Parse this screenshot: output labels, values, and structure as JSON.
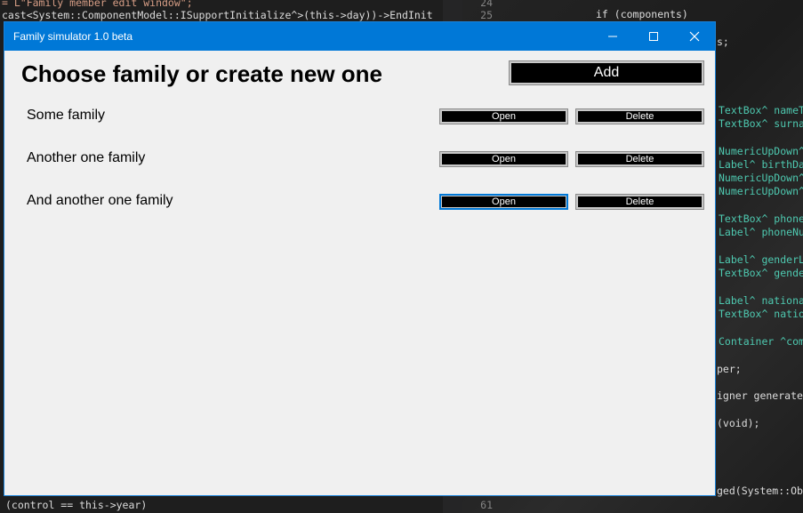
{
  "ide": {
    "left_lines": [
      {
        "text": "= L\"Family member edit window\";",
        "cls": "t-str"
      },
      {
        "text": "cast<System::ComponentModel::ISupportInitialize^>(this->day))->EndInit",
        "cls": "t-plain"
      },
      {
        "text": "(control == this->year)",
        "cls": "t-plain"
      }
    ],
    "gutter": [
      "24",
      "25",
      "61"
    ],
    "right_lines": [
      {
        "text": "if (components)",
        "cls": "t-plain"
      },
      {
        "text": "s;",
        "cls": "t-plain"
      },
      {
        "text": "TextBox^ nameT",
        "cls": "t-type"
      },
      {
        "text": "TextBox^ surna",
        "cls": "t-type"
      },
      {
        "text": "NumericUpDown^",
        "cls": "t-type"
      },
      {
        "text": "Label^ birthDa",
        "cls": "t-type"
      },
      {
        "text": "NumericUpDown^",
        "cls": "t-type"
      },
      {
        "text": "NumericUpDown^",
        "cls": "t-type"
      },
      {
        "text": "TextBox^ phone",
        "cls": "t-type"
      },
      {
        "text": "Label^ phoneNu",
        "cls": "t-type"
      },
      {
        "text": "Label^ genderL",
        "cls": "t-type"
      },
      {
        "text": "TextBox^ gende",
        "cls": "t-type"
      },
      {
        "text": "Label^ nationa",
        "cls": "t-type"
      },
      {
        "text": "TextBox^ natio",
        "cls": "t-type"
      },
      {
        "text": "Container ^com",
        "cls": "t-type"
      },
      {
        "text": "per;",
        "cls": "t-plain"
      },
      {
        "text": "igner generated",
        "cls": "t-plain"
      },
      {
        "text": "(void);",
        "cls": "t-plain"
      },
      {
        "text": "ged(System::Obj",
        "cls": "t-plain"
      }
    ]
  },
  "window": {
    "title": "Family simulator 1.0 beta",
    "minimize_icon": "minimize-icon",
    "maximize_icon": "maximize-icon",
    "close_icon": "close-icon"
  },
  "main": {
    "heading": "Choose family or create new one",
    "add_label": "Add",
    "families": [
      {
        "name": "Some family",
        "open_label": "Open",
        "delete_label": "Delete"
      },
      {
        "name": "Another one family",
        "open_label": "Open",
        "delete_label": "Delete"
      },
      {
        "name": "And another one family",
        "open_label": "Open",
        "delete_label": "Delete"
      }
    ]
  },
  "colors": {
    "titlebar": "#0078d7",
    "window_bg": "#f0f0f0",
    "button_bg": "#000000"
  }
}
